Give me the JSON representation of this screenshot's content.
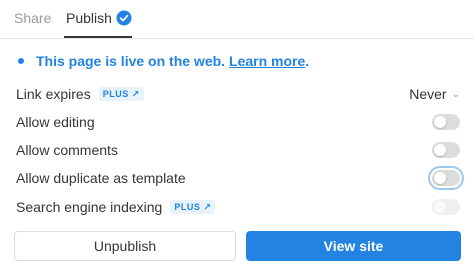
{
  "tabs": [
    {
      "label": "Share",
      "active": false
    },
    {
      "label": "Publish",
      "active": true,
      "icon": "verified-check-icon"
    }
  ],
  "live_banner": {
    "text": "This page is live on the web.",
    "link": "Learn more",
    "suffix": "."
  },
  "settings": {
    "link_expires": {
      "label": "Link expires",
      "badge": "PLUS",
      "value": "Never"
    },
    "allow_editing": {
      "label": "Allow editing",
      "enabled": false
    },
    "allow_comments": {
      "label": "Allow comments",
      "enabled": false
    },
    "allow_duplicate": {
      "label": "Allow duplicate as template",
      "enabled": false
    },
    "search_indexing": {
      "label": "Search engine indexing",
      "badge": "PLUS",
      "enabled": false,
      "disabled": true
    }
  },
  "buttons": {
    "unpublish": "Unpublish",
    "view_site": "View site"
  },
  "colors": {
    "accent": "#2383e2",
    "text": "#37352f",
    "muted": "#9b9a97"
  }
}
